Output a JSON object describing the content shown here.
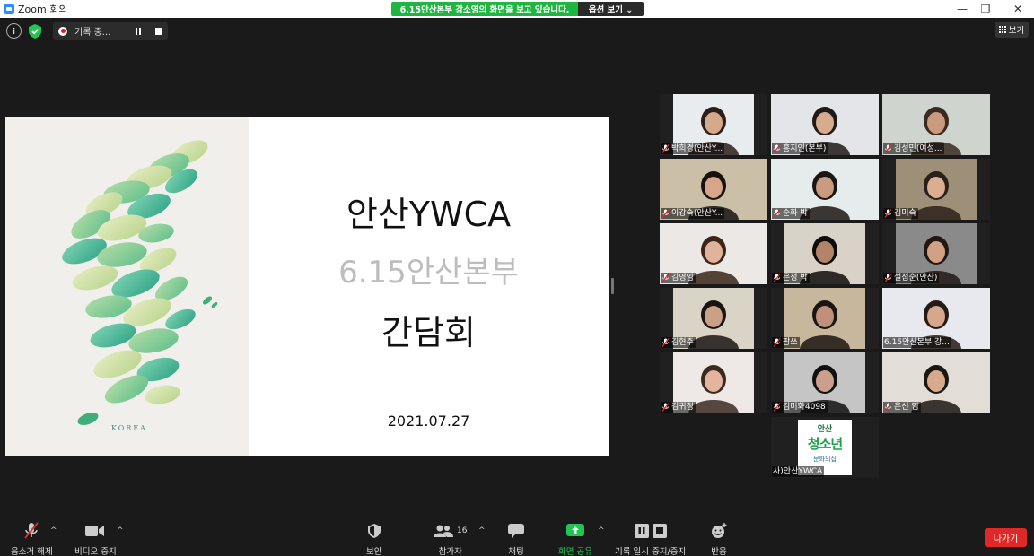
{
  "window": {
    "title": "Zoom 회의",
    "controls": [
      "—",
      "❐",
      "✕"
    ]
  },
  "share_banner": {
    "text": "6.15안산본부 강소영의 화면을 보고 있습니다.",
    "view_options": "옵션 보기 ⌄"
  },
  "top_bar": {
    "recording_label": "기록 중...",
    "view_label": "보기"
  },
  "slide": {
    "title": "안산YWCA",
    "subtitle": "6.15안산본부",
    "event": "간담회",
    "date": "2021.07.27",
    "art_label": "KOREA"
  },
  "participants": [
    {
      "name": "박희경(안산Y...",
      "muted": true,
      "bg": "#e9ecef",
      "skin": "#d6a98c",
      "hair": "#2a1f1a",
      "wide": false
    },
    {
      "name": "홍지인(본부)",
      "muted": true,
      "bg": "#e4e5e8",
      "skin": "#d9ab8e",
      "hair": "#1e1a18",
      "wide": true
    },
    {
      "name": "김성민(여성...",
      "muted": true,
      "bg": "#cfd4cf",
      "skin": "#c99a7e",
      "hair": "#3a2a20",
      "wide": true
    },
    {
      "name": "이강숙(안산Y...",
      "muted": true,
      "bg": "#cbbfa8",
      "skin": "#d9a588",
      "hair": "#151210",
      "wide": true
    },
    {
      "name": "순화 박",
      "muted": true,
      "bg": "#e6ebec",
      "skin": "#c99b80",
      "hair": "#1b1614",
      "wide": true
    },
    {
      "name": "김미숙",
      "muted": true,
      "bg": "#9e8f78",
      "skin": "#dcae90",
      "hair": "#2b2019",
      "wide": false
    },
    {
      "name": "김영임",
      "muted": true,
      "bg": "#ece8e6",
      "skin": "#e0b39a",
      "hair": "#3b2418",
      "wide": true
    },
    {
      "name": "은정 박",
      "muted": true,
      "bg": "#d8d2c8",
      "skin": "#b48468",
      "hair": "#0e0c0b",
      "wide": false
    },
    {
      "name": "설점순(안산)",
      "muted": true,
      "bg": "#8a8a8a",
      "skin": "#d4a084",
      "hair": "#201813",
      "wide": false
    },
    {
      "name": "김현주",
      "muted": true,
      "bg": "#d9d4c6",
      "skin": "#caa086",
      "hair": "#1a1512",
      "wide": false
    },
    {
      "name": "팡쓰",
      "muted": true,
      "bg": "#c7b79c",
      "skin": "#c0907a",
      "hair": "#1b1512",
      "wide": false
    },
    {
      "name": "6.15안산본부 강...",
      "muted": false,
      "bg": "#e8e9ee",
      "skin": "#d7a78c",
      "hair": "#251b16",
      "wide": true,
      "active": true
    },
    {
      "name": "김귀정",
      "muted": true,
      "bg": "#eee8e6",
      "skin": "#e3b59d",
      "hair": "#3a2a22",
      "wide": false
    },
    {
      "name": "김미화4098",
      "muted": true,
      "bg": "#c5c5c5",
      "skin": "#caa08a",
      "hair": "#111111",
      "wide": false
    },
    {
      "name": "은선 임",
      "muted": true,
      "bg": "#e2ddd6",
      "skin": "#d8aa8d",
      "hair": "#1c1613",
      "wide": true
    },
    {
      "name": "사)안산YWCA",
      "muted": false,
      "bg": "#ffffff",
      "logo": true,
      "logo_lines": [
        "안산",
        "청소년",
        "문화의집"
      ]
    }
  ],
  "toolbar": {
    "audio_label": "음소거 해제",
    "video_label": "비디오 중지",
    "security_label": "보안",
    "participants_label": "참가자",
    "participants_count": "16",
    "chat_label": "채팅",
    "share_label": "화면 공유",
    "recording_label": "기록 일시 중지/중지",
    "reactions_label": "반응",
    "leave_label": "나가기"
  },
  "colors": {
    "share_green": "#1fb541",
    "active_tile": "#b8d83b",
    "leave_red": "#e02828",
    "zoom_blue": "#2d8cff"
  }
}
